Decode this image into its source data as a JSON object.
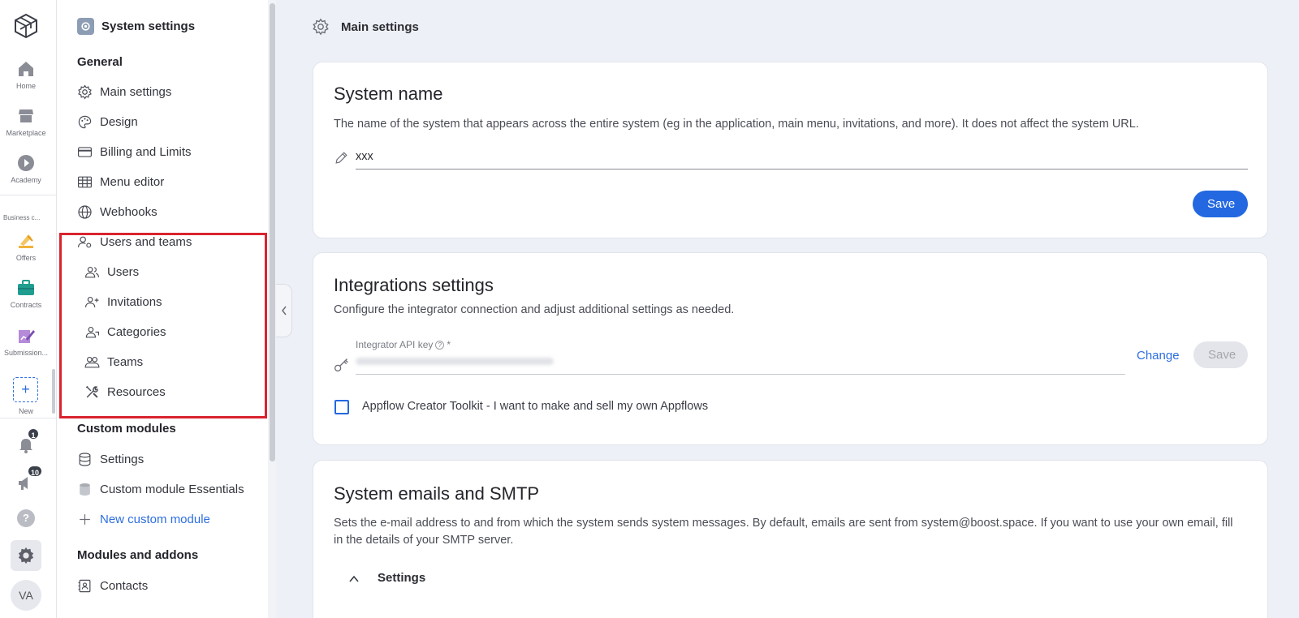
{
  "rail": {
    "items": [
      {
        "label": "Home",
        "icon": "home-icon"
      },
      {
        "label": "Marketplace",
        "icon": "store-icon"
      },
      {
        "label": "Academy",
        "icon": "play-icon"
      },
      {
        "label": "Offers",
        "icon": "offers-icon"
      },
      {
        "label": "Contracts",
        "icon": "briefcase-icon"
      },
      {
        "label": "Submission...",
        "icon": "edit-chart-icon"
      },
      {
        "label": "New",
        "icon": "plus-icon"
      }
    ],
    "section_label": "Business c...",
    "new_symbol": "+",
    "notifications_count": "1",
    "announcements_count": "10",
    "help_symbol": "?",
    "avatar_initials": "VA"
  },
  "sidebar": {
    "title": "System settings",
    "groups": {
      "general": "General",
      "custom_modules": "Custom modules",
      "modules_addons": "Modules and addons"
    },
    "items": {
      "main_settings": "Main settings",
      "design": "Design",
      "billing": "Billing and Limits",
      "menu_editor": "Menu editor",
      "webhooks": "Webhooks",
      "users_teams": "Users and teams",
      "users": "Users",
      "invitations": "Invitations",
      "categories": "Categories",
      "teams": "Teams",
      "resources": "Resources",
      "settings": "Settings",
      "essentials": "Custom module Essentials",
      "new_custom_module": "New custom module",
      "contacts": "Contacts"
    }
  },
  "topbar": {
    "title": "Main settings"
  },
  "system_name": {
    "heading": "System name",
    "description": "The name of the system that appears across the entire system (eg in the application, main menu, invitations, and more). It does not affect the system URL.",
    "value": "xxx",
    "save": "Save"
  },
  "integrations": {
    "heading": "Integrations settings",
    "description": "Configure the integrator connection and adjust additional settings as needed.",
    "api_key_label": "Integrator API key",
    "required_mark": "*",
    "change": "Change",
    "save": "Save",
    "toolkit_label": "Appflow Creator Toolkit - I want to make and sell my own Appflows"
  },
  "smtp": {
    "heading": "System emails and SMTP",
    "description": "Sets the e-mail address to and from which the system sends system messages. By default, emails are sent from system@boost.space. If you want to use your own email, fill in the details of your SMTP server.",
    "settings_label": "Settings"
  },
  "colors": {
    "accent": "#2368e0",
    "highlight": "#d9232e"
  }
}
